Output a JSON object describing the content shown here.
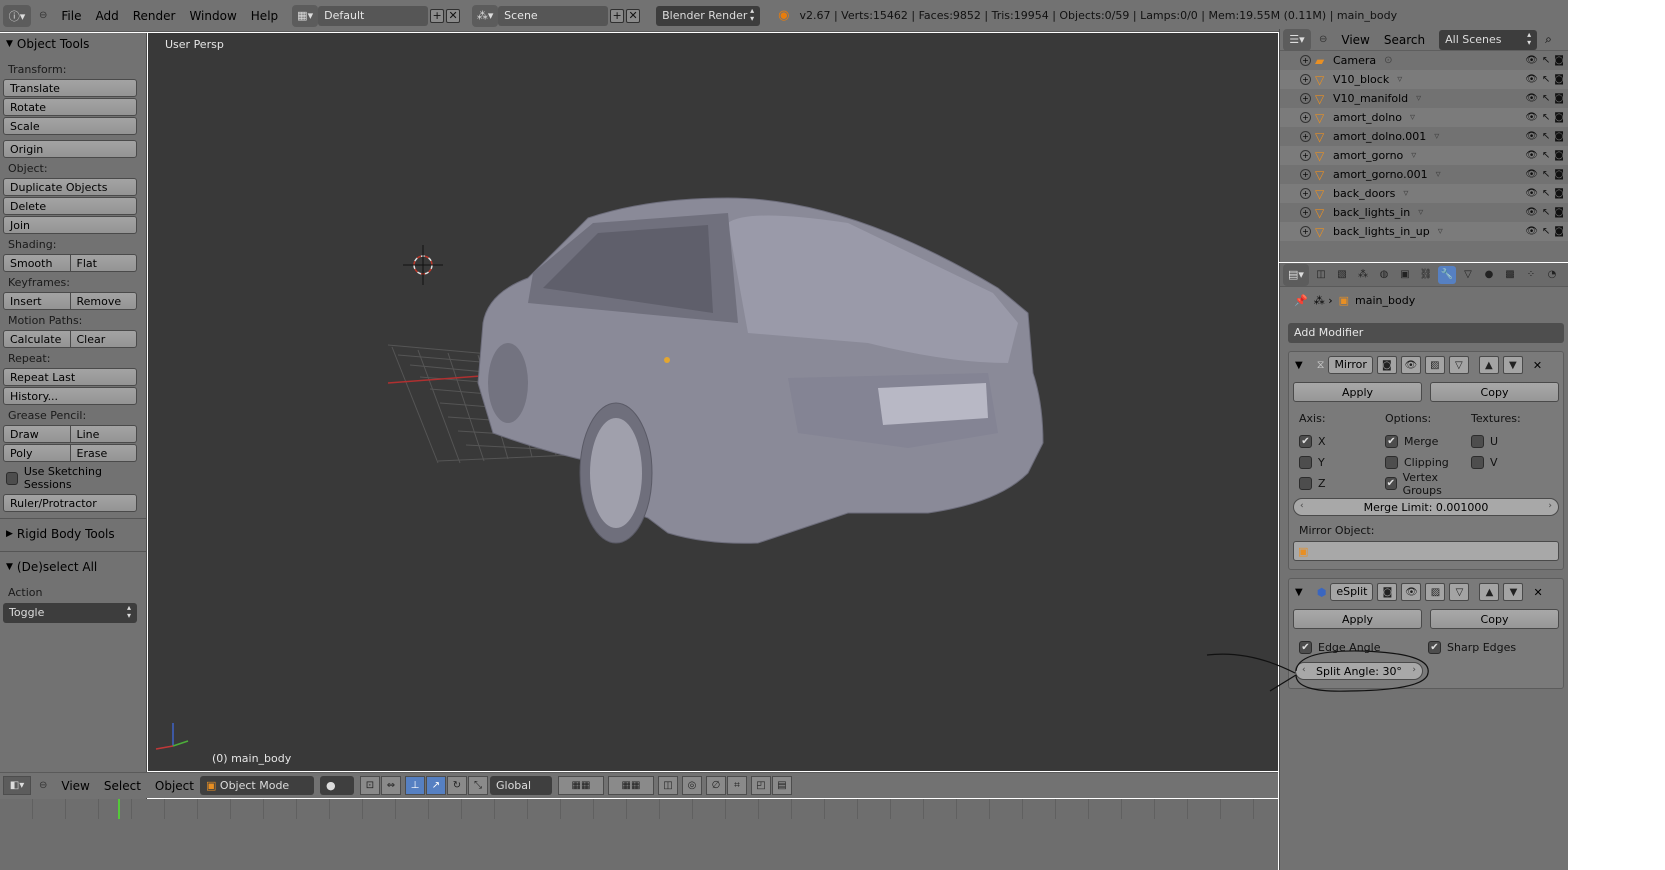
{
  "topbar": {
    "menus": [
      "File",
      "Add",
      "Render",
      "Window",
      "Help"
    ],
    "screen_layout": "Default",
    "scene": "Scene",
    "render_engine": "Blender Render",
    "stats": "v2.67 | Verts:15462 | Faces:9852 | Tris:19954 | Objects:0/59 | Lamps:0/0 | Mem:19.55M (0.11M) | main_body"
  },
  "toolshelf": {
    "title": "Object Tools",
    "transform_label": "Transform:",
    "translate": "Translate",
    "rotate": "Rotate",
    "scale": "Scale",
    "origin": "Origin",
    "object_label": "Object:",
    "duplicate": "Duplicate Objects",
    "delete": "Delete",
    "join": "Join",
    "shading_label": "Shading:",
    "smooth": "Smooth",
    "flat": "Flat",
    "keyframes_label": "Keyframes:",
    "insert": "Insert",
    "remove": "Remove",
    "motion_label": "Motion Paths:",
    "calculate": "Calculate",
    "clear": "Clear",
    "repeat_label": "Repeat:",
    "repeat_last": "Repeat Last",
    "history": "History...",
    "grease_label": "Grease Pencil:",
    "draw": "Draw",
    "line": "Line",
    "poly": "Poly",
    "erase": "Erase",
    "sketching": "Use Sketching Sessions",
    "ruler": "Ruler/Protractor",
    "rigid_body": "Rigid Body Tools",
    "deselect_all": "(De)select All",
    "action_label": "Action",
    "action_value": "Toggle"
  },
  "viewport": {
    "label": "User Persp",
    "object_label": "(0) main_body"
  },
  "view_header": {
    "menus": [
      "View",
      "Select",
      "Object"
    ],
    "mode": "Object Mode",
    "orientation": "Global"
  },
  "outliner": {
    "menus": [
      "View",
      "Search"
    ],
    "scene_filter": "All Scenes",
    "items": [
      {
        "name": "Camera",
        "icon": "camera-icon"
      },
      {
        "name": "V10_block",
        "icon": "mesh-icon"
      },
      {
        "name": "V10_manifold",
        "icon": "mesh-icon"
      },
      {
        "name": "amort_dolno",
        "icon": "mesh-icon"
      },
      {
        "name": "amort_dolno.001",
        "icon": "mesh-icon"
      },
      {
        "name": "amort_gorno",
        "icon": "mesh-icon"
      },
      {
        "name": "amort_gorno.001",
        "icon": "mesh-icon"
      },
      {
        "name": "back_doors",
        "icon": "mesh-icon"
      },
      {
        "name": "back_lights_in",
        "icon": "mesh-icon"
      },
      {
        "name": "back_lights_in_up",
        "icon": "mesh-icon"
      }
    ]
  },
  "properties": {
    "object": "main_body",
    "add_modifier": "Add Modifier",
    "mirror": {
      "name": "Mirror",
      "apply": "Apply",
      "copy": "Copy",
      "axis_label": "Axis:",
      "options_label": "Options:",
      "textures_label": "Textures:",
      "x": "X",
      "y": "Y",
      "z": "Z",
      "merge": "Merge",
      "clipping": "Clipping",
      "vertex_groups": "Vertex Groups",
      "u": "U",
      "v": "V",
      "merge_limit": "Merge Limit: 0.001000",
      "mirror_object_label": "Mirror Object:"
    },
    "edgesplit": {
      "name": "eSplit",
      "apply": "Apply",
      "copy": "Copy",
      "edge_angle": "Edge Angle",
      "sharp_edges": "Sharp Edges",
      "split_angle": "Split Angle: 30°"
    }
  }
}
